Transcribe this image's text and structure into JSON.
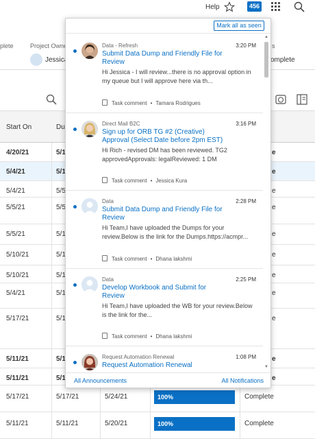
{
  "topbar": {
    "help": "Help",
    "badge_count": "456",
    "icons": [
      "star-icon",
      "grid-icon",
      "search-icon"
    ]
  },
  "project": {
    "complete_label": "plete",
    "owner_label": "Project Owne",
    "owner_name": "Jessica",
    "right_label": "s",
    "right_value": "omplete"
  },
  "table": {
    "headers": [
      "Start On",
      "Du"
    ],
    "rows": [
      {
        "start": "4/20/21",
        "due": "5/1",
        "status": "e",
        "bold": true
      },
      {
        "start": "5/4/21",
        "due": "5/1",
        "status": "e",
        "bold": true
      },
      {
        "start": "5/4/21",
        "due": "5/5",
        "status": "e",
        "bold": false
      },
      {
        "start": "5/5/21",
        "due": "5/5",
        "status": "e",
        "bold": false
      },
      {
        "start": "5/5/21",
        "due": "5/1",
        "status": "e",
        "bold": false
      },
      {
        "start": "5/10/21",
        "due": "5/1",
        "status": "e",
        "bold": false
      },
      {
        "start": "5/10/21",
        "due": "5/1",
        "status": "e",
        "bold": false
      },
      {
        "start": "5/4/21",
        "due": "5/1",
        "status": "e",
        "bold": false
      },
      {
        "start": "5/17/21",
        "due": "5/1",
        "status": "e",
        "bold": false
      },
      {
        "start": "5/11/21",
        "due": "5/1",
        "status": "e",
        "bold": true
      },
      {
        "start": "5/11/21",
        "due": "5/1",
        "status": "e",
        "bold": true
      },
      {
        "start": "5/17/21",
        "due": "5/17/21",
        "end": "5/24/21",
        "progress": "100%",
        "progress_value": 1.0,
        "status": "Complete",
        "bold": false
      },
      {
        "start": "5/11/21",
        "due": "5/11/21",
        "end": "5/20/21",
        "progress": "100%",
        "progress_value": 1.0,
        "status": "Complete",
        "bold": false
      }
    ]
  },
  "notifications": {
    "mark_all": "Mark all as seen",
    "items": [
      {
        "category": "Data - Refresh",
        "time": "3:20 PM",
        "title": "Submit Data Dump and Friendly File for Review",
        "body": "Hi Jessica - I will review...there is no approval option in my queue but I will approve here via th...",
        "meta_type": "Task comment",
        "author": "Tamara Rodrigues",
        "avatar": "photo-dark"
      },
      {
        "category": "Direct Mail B2C",
        "time": "3:16 PM",
        "title": "Sign up for ORB TG #2 (Creative) Approval (Select Date before 2pm EST)",
        "body": "Hi Rich - revised DM has been reviewed. TG2 approvedApprovals: legalReviewed: 1 DM",
        "meta_type": "Task comment",
        "author": "Jessica Kura",
        "avatar": "photo-blonde"
      },
      {
        "category": "Data",
        "time": "2:28 PM",
        "title": "Submit Data Dump and Friendly File for Review",
        "body": "Hi Team,I have uploaded the Dumps for your review.Below is the link for the Dumps.https://acmpr...",
        "meta_type": "Task comment",
        "author": "Dhana lakshmi",
        "avatar": "placeholder"
      },
      {
        "category": "Data",
        "time": "2:25 PM",
        "title": "Develop Workbook and Submit for Review",
        "body": "Hi Team,I have uploaded the WB for your review.Below is the link for the...",
        "meta_type": "Task comment",
        "author": "Dhana lakshmi",
        "avatar": "placeholder"
      },
      {
        "category": "Request Automation Renewal",
        "time": "1:08 PM",
        "title": "Request Automation Renewal",
        "body": "",
        "meta_type": "",
        "author": "",
        "avatar": "photo-red"
      }
    ],
    "footer": {
      "left": "All Announcements",
      "right": "All Notifications"
    }
  },
  "colors": {
    "accent": "#0a70c5",
    "selected_row": "#eaf4fc"
  }
}
